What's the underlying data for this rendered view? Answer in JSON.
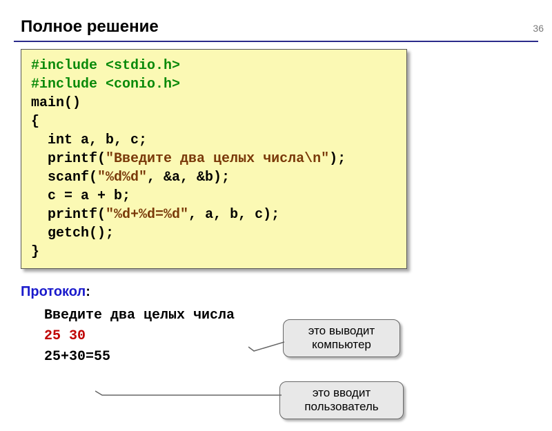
{
  "page_number": "36",
  "title": "Полное решение",
  "code": {
    "l1a": "#include <stdio.h>",
    "l2a": "#include <conio.h>",
    "l3": "main()",
    "l4": "{",
    "l5a": "  int",
    "l5b": " a, b, c;",
    "l6a": "  printf(",
    "l6b": "\"Введите два целых числа\\n\"",
    "l6c": ");",
    "l7a": "  scanf(",
    "l7b": "\"%d%d\"",
    "l7c": ", &a, &b);",
    "l8": "  c = a + b;",
    "l9a": "  printf(",
    "l9b": "\"%d+%d=%d\"",
    "l9c": ", a, b, c);",
    "l10": "  getch();",
    "l11": "}"
  },
  "protocol_label": "Протокол",
  "protocol": {
    "prompt": "Введите два целых числа",
    "input": "25 30",
    "output": "25+30=55"
  },
  "callouts": {
    "computer": "это выводит компьютер",
    "user": "это вводит пользователь"
  }
}
